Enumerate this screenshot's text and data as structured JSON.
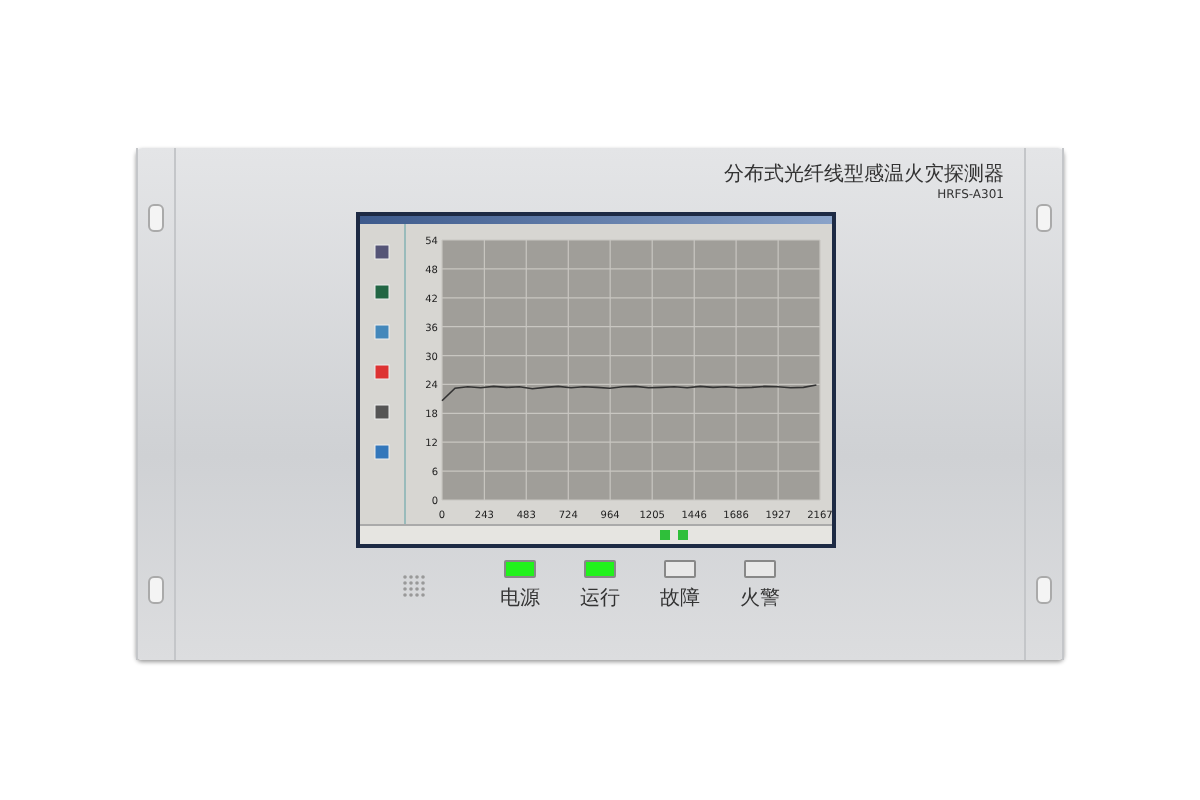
{
  "device": {
    "title": "分布式光纤线型感温火灾探测器",
    "model": "HRFS-A301"
  },
  "screen": {
    "chart_data": {
      "type": "line",
      "grid": true,
      "xlim": [
        0,
        2167
      ],
      "ylim": [
        0,
        54
      ],
      "xticks": [
        0,
        243,
        483,
        724,
        964,
        1205,
        1446,
        1686,
        1927,
        2167
      ],
      "yticks": [
        0,
        6,
        12,
        18,
        24,
        30,
        36,
        42,
        48,
        54
      ],
      "x": [
        0,
        74,
        148,
        222,
        296,
        370,
        444,
        518,
        592,
        666,
        740,
        814,
        888,
        962,
        1036,
        1110,
        1184,
        1258,
        1332,
        1406,
        1480,
        1554,
        1628,
        1702,
        1776,
        1850,
        1924,
        1998,
        2072,
        2146
      ],
      "series": [
        {
          "color": "#333333",
          "values": [
            20.6,
            23.2,
            23.5,
            23.3,
            23.6,
            23.4,
            23.5,
            23.1,
            23.4,
            23.6,
            23.3,
            23.5,
            23.4,
            23.2,
            23.5,
            23.6,
            23.3,
            23.4,
            23.5,
            23.3,
            23.6,
            23.4,
            23.5,
            23.3,
            23.4,
            23.6,
            23.5,
            23.3,
            23.4,
            23.9
          ]
        }
      ]
    }
  },
  "leds": [
    {
      "label": "电源",
      "lit": true
    },
    {
      "label": "运行",
      "lit": true
    },
    {
      "label": "故障",
      "lit": false
    },
    {
      "label": "火警",
      "lit": false
    }
  ]
}
